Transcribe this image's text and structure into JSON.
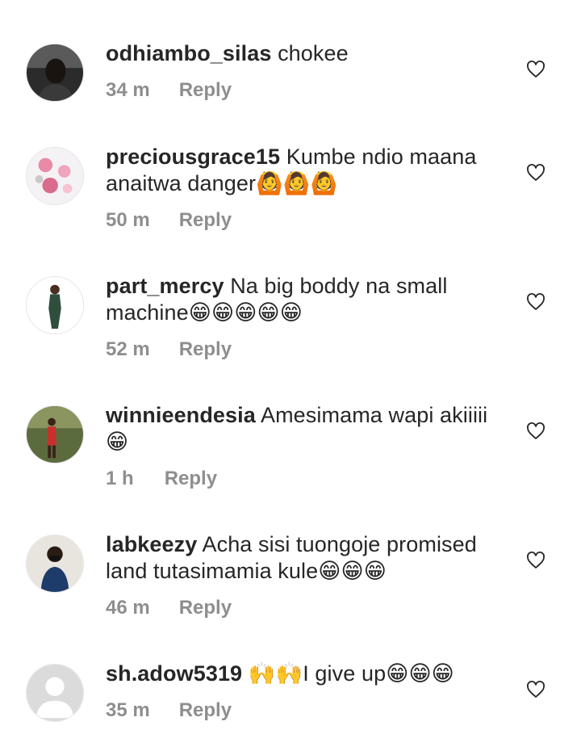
{
  "comments": [
    {
      "username": "odhiambo_silas",
      "text": " chokee",
      "time": "34 m",
      "reply_label": "Reply"
    },
    {
      "username": "preciousgrace15",
      "text": " Kumbe ndio maana anaitwa danger🙆🙆🙆",
      "time": "50 m",
      "reply_label": "Reply"
    },
    {
      "username": "part_mercy",
      "text": " Na big boddy na small machine😁😁😁😁😁",
      "time": "52 m",
      "reply_label": "Reply"
    },
    {
      "username": "winnieendesia",
      "text": " Amesimama wapi akiiiii 😁",
      "time": "1 h",
      "reply_label": "Reply"
    },
    {
      "username": "labkeezy",
      "text": " Acha sisi tuongoje promised land tutasimamia kule😁😁😁",
      "time": "46 m",
      "reply_label": "Reply"
    },
    {
      "username": "sh.adow5319",
      "text": " 🙌🙌I give up😁😁😁",
      "time": "35 m",
      "reply_label": "Reply"
    }
  ],
  "icons": {
    "like": "heart-outline-icon"
  },
  "colors": {
    "text": "#262626",
    "meta": "#8e8e8e",
    "background": "#ffffff"
  }
}
